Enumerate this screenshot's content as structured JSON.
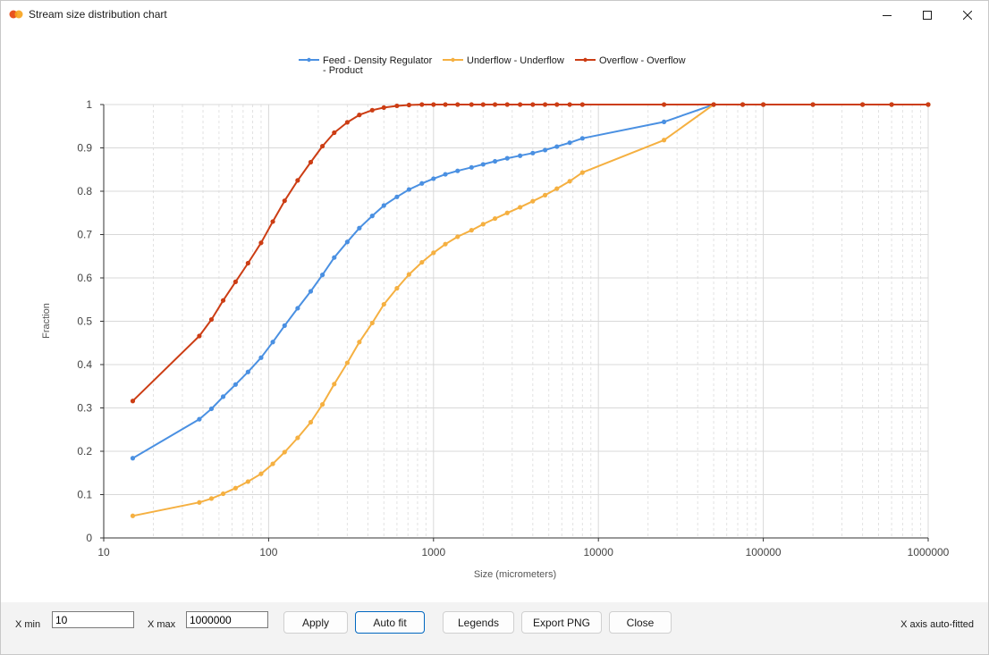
{
  "window": {
    "title": "Stream size distribution chart",
    "controls": {
      "minimize": "minimize-icon",
      "maximize": "maximize-icon",
      "close": "close-icon"
    }
  },
  "chart_data": {
    "type": "line",
    "xlabel": "Size (micrometers)",
    "ylabel": "Fraction",
    "xscale": "log",
    "xlim": [
      10,
      1000000
    ],
    "ylim": [
      0,
      1
    ],
    "x_ticks": [
      "10",
      "100",
      "1000",
      "10000",
      "100000",
      "1000000"
    ],
    "y_ticks": [
      "0",
      "0.1",
      "0.2",
      "0.3",
      "0.4",
      "0.5",
      "0.6",
      "0.7",
      "0.8",
      "0.9",
      "1"
    ],
    "grid": true,
    "legend_position": "top-center",
    "series": [
      {
        "name": "Feed - Density Regulator - Product",
        "legend_lines": [
          "Feed - Density Regulator",
          "- Product"
        ],
        "color": "#4a90e2",
        "x": [
          15,
          38,
          45,
          53,
          63,
          75,
          90,
          106,
          125,
          150,
          180,
          212,
          250,
          300,
          355,
          425,
          500,
          600,
          710,
          850,
          1000,
          1180,
          1400,
          1700,
          2000,
          2360,
          2800,
          3350,
          4000,
          4750,
          5600,
          6700,
          8000,
          25000,
          50000,
          75000,
          100000,
          200000,
          400000,
          600000,
          1000000
        ],
        "y": [
          0.184,
          0.274,
          0.298,
          0.326,
          0.354,
          0.383,
          0.416,
          0.452,
          0.49,
          0.53,
          0.569,
          0.607,
          0.647,
          0.683,
          0.715,
          0.743,
          0.767,
          0.787,
          0.804,
          0.818,
          0.829,
          0.839,
          0.847,
          0.855,
          0.862,
          0.869,
          0.876,
          0.882,
          0.888,
          0.895,
          0.903,
          0.912,
          0.922,
          0.96,
          1.0,
          1.0,
          1.0,
          1.0,
          1.0,
          1.0,
          1.0
        ]
      },
      {
        "name": "Underflow - Underflow",
        "color": "#f5b041",
        "x": [
          15,
          38,
          45,
          53,
          63,
          75,
          90,
          106,
          125,
          150,
          180,
          212,
          250,
          300,
          355,
          425,
          500,
          600,
          710,
          850,
          1000,
          1180,
          1400,
          1700,
          2000,
          2360,
          2800,
          3350,
          4000,
          4750,
          5600,
          6700,
          8000,
          25000,
          50000,
          75000,
          100000,
          200000,
          400000,
          600000,
          1000000
        ],
        "y": [
          0.051,
          0.082,
          0.091,
          0.102,
          0.115,
          0.13,
          0.148,
          0.171,
          0.198,
          0.231,
          0.267,
          0.308,
          0.355,
          0.404,
          0.452,
          0.496,
          0.539,
          0.576,
          0.608,
          0.636,
          0.658,
          0.678,
          0.695,
          0.71,
          0.724,
          0.737,
          0.75,
          0.763,
          0.777,
          0.791,
          0.806,
          0.823,
          0.843,
          0.918,
          1.0,
          1.0,
          1.0,
          1.0,
          1.0,
          1.0,
          1.0
        ]
      },
      {
        "name": "Overflow - Overflow",
        "color": "#cc3d14",
        "x": [
          15,
          38,
          45,
          53,
          63,
          75,
          90,
          106,
          125,
          150,
          180,
          212,
          250,
          300,
          355,
          425,
          500,
          600,
          710,
          850,
          1000,
          1180,
          1400,
          1700,
          2000,
          2360,
          2800,
          3350,
          4000,
          4750,
          5600,
          6700,
          8000,
          25000,
          50000,
          75000,
          100000,
          200000,
          400000,
          600000,
          1000000
        ],
        "y": [
          0.316,
          0.466,
          0.504,
          0.548,
          0.591,
          0.634,
          0.681,
          0.73,
          0.778,
          0.825,
          0.867,
          0.904,
          0.935,
          0.959,
          0.976,
          0.987,
          0.993,
          0.997,
          0.999,
          1.0,
          1.0,
          1.0,
          1.0,
          1.0,
          1.0,
          1.0,
          1.0,
          1.0,
          1.0,
          1.0,
          1.0,
          1.0,
          1.0,
          1.0,
          1.0,
          1.0,
          1.0,
          1.0,
          1.0,
          1.0,
          1.0
        ]
      }
    ]
  },
  "controls": {
    "xmin_label": "X min",
    "xmin_value": "10",
    "xmax_label": "X max",
    "xmax_value": "1000000",
    "apply_label": "Apply",
    "autofit_label": "Auto fit",
    "legends_label": "Legends",
    "export_label": "Export PNG",
    "close_label": "Close",
    "status": "X axis auto-fitted"
  }
}
